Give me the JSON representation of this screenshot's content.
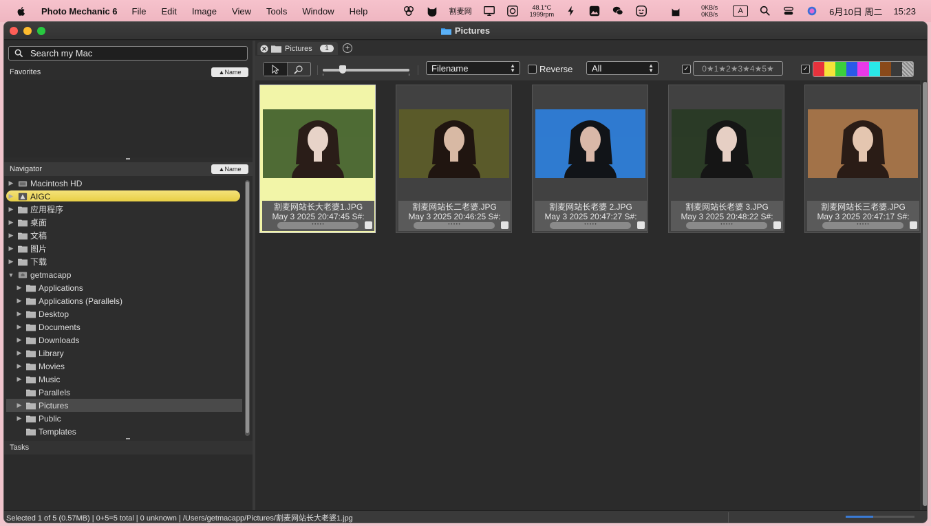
{
  "menubar": {
    "app_name": "Photo Mechanic 6",
    "menus": [
      "File",
      "Edit",
      "Image",
      "View",
      "Tools",
      "Window",
      "Help"
    ],
    "tray": {
      "site": "割麦网",
      "temp": "48.1°C",
      "rpm": "1999rpm",
      "net_up": "0KB/s",
      "net_down": "0KB/s",
      "input_method": "A",
      "date": "6月10日 周二",
      "time": "15:23"
    }
  },
  "window": {
    "title": "Pictures"
  },
  "sidebar": {
    "search_placeholder": "Search my Mac",
    "favorites_label": "Favorites",
    "navigator_label": "Navigator",
    "tasks_label": "Tasks",
    "sort_label": "▲Name",
    "tree": [
      {
        "label": "Macintosh HD",
        "level": 1,
        "expand": "▶",
        "icon": "disk-icon"
      },
      {
        "label": "AIGC",
        "level": 1,
        "expand": "▶",
        "icon": "aigc-icon",
        "selected": "yellow"
      },
      {
        "label": "应用程序",
        "level": 1,
        "expand": "▶",
        "icon": "folder-icon"
      },
      {
        "label": "桌面",
        "level": 1,
        "expand": "▶",
        "icon": "folder-icon"
      },
      {
        "label": "文稿",
        "level": 1,
        "expand": "▶",
        "icon": "folder-icon"
      },
      {
        "label": "图片",
        "level": 1,
        "expand": "▶",
        "icon": "folder-icon"
      },
      {
        "label": "下载",
        "level": 1,
        "expand": "▶",
        "icon": "folder-icon"
      },
      {
        "label": "getmacapp",
        "level": 1,
        "expand": "▼",
        "icon": "home-icon"
      },
      {
        "label": "Applications",
        "level": 2,
        "expand": "▶",
        "icon": "folder-icon"
      },
      {
        "label": "Applications (Parallels)",
        "level": 2,
        "expand": "▶",
        "icon": "folder-icon"
      },
      {
        "label": "Desktop",
        "level": 2,
        "expand": "▶",
        "icon": "folder-icon"
      },
      {
        "label": "Documents",
        "level": 2,
        "expand": "▶",
        "icon": "folder-icon"
      },
      {
        "label": "Downloads",
        "level": 2,
        "expand": "▶",
        "icon": "folder-icon"
      },
      {
        "label": "Library",
        "level": 2,
        "expand": "▶",
        "icon": "folder-icon"
      },
      {
        "label": "Movies",
        "level": 2,
        "expand": "▶",
        "icon": "folder-icon"
      },
      {
        "label": "Music",
        "level": 2,
        "expand": "▶",
        "icon": "folder-icon"
      },
      {
        "label": "Parallels",
        "level": 2,
        "expand": "",
        "icon": "folder-icon"
      },
      {
        "label": "Pictures",
        "level": 2,
        "expand": "▶",
        "icon": "folder-icon",
        "selected": "grey"
      },
      {
        "label": "Public",
        "level": 2,
        "expand": "▶",
        "icon": "folder-icon"
      },
      {
        "label": "Templates",
        "level": 2,
        "expand": "",
        "icon": "folder-icon"
      }
    ]
  },
  "contact_sheet": {
    "tab_label": "Pictures",
    "tab_count": "1",
    "sort_field": "Filename",
    "reverse_label": "Reverse",
    "filter": "All",
    "stars": "0★1★2★3★4★5★",
    "colors": [
      "#e8323c",
      "#f5e23a",
      "#3ccf3c",
      "#2a5ae8",
      "#e83ae8",
      "#2ae8e8",
      "#8a4a1a",
      "#3a3a3a"
    ],
    "items": [
      {
        "filename": "割麦网站长大老婆1.JPG",
        "date": "May 3 2025 20:47:45 S#:",
        "selected": true,
        "palette": [
          "#4f6b35",
          "#2a1d18",
          "#e7d3c8"
        ]
      },
      {
        "filename": "割麦网站长二老婆.JPG",
        "date": "May 3 2025 20:46:25 S#:",
        "selected": false,
        "palette": [
          "#5a5a2a",
          "#201510",
          "#d8b9a4"
        ]
      },
      {
        "filename": "割麦网站长老婆 2.JPG",
        "date": "May 3 2025 20:47:27 S#:",
        "selected": false,
        "palette": [
          "#2f7bd0",
          "#111418",
          "#d9b8a8"
        ]
      },
      {
        "filename": "割麦网站长老婆 3.JPG",
        "date": "May 3 2025 20:48:22 S#:",
        "selected": false,
        "palette": [
          "#2b3b26",
          "#151515",
          "#e6cfc4"
        ]
      },
      {
        "filename": "割麦网站长三老婆.JPG",
        "date": "May 3 2025 20:47:17 S#:",
        "selected": false,
        "palette": [
          "#a27248",
          "#2a1c16",
          "#e4c6b0"
        ]
      }
    ]
  },
  "status": {
    "text": "Selected 1 of 5 (0.57MB) | 0+5=5 total | 0 unknown | /Users/getmacapp/Pictures/割麦网站长大老婆1.jpg"
  }
}
